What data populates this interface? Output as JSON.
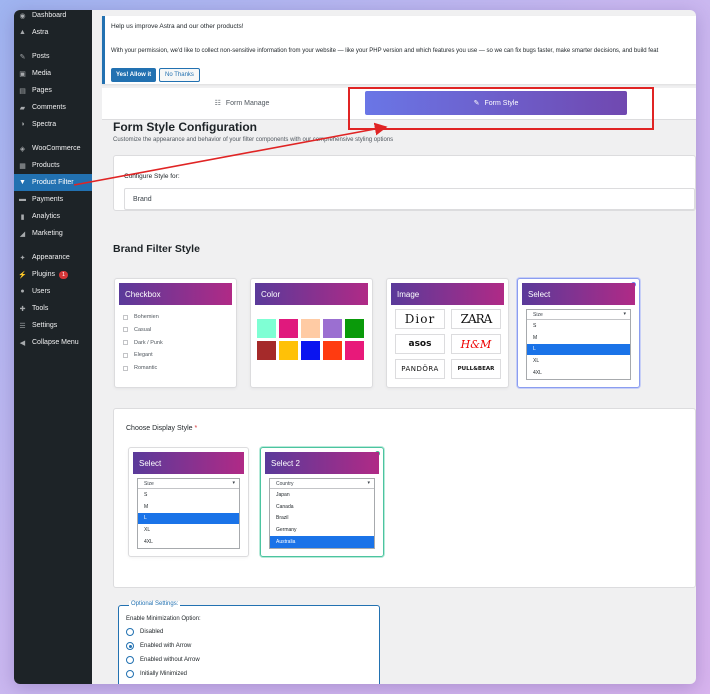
{
  "sidebar": {
    "items": [
      {
        "label": "Dashboard",
        "icon": "dashboard-icon",
        "glyph": "◉"
      },
      {
        "label": "Astra",
        "icon": "astra-icon",
        "glyph": "▲"
      },
      {
        "label": "Posts",
        "icon": "pin-icon",
        "glyph": "✎"
      },
      {
        "label": "Media",
        "icon": "media-icon",
        "glyph": "▣"
      },
      {
        "label": "Pages",
        "icon": "pages-icon",
        "glyph": "▤"
      },
      {
        "label": "Comments",
        "icon": "comments-icon",
        "glyph": "▰"
      },
      {
        "label": "Spectra",
        "icon": "spectra-icon",
        "glyph": "◑"
      },
      {
        "label": "WooCommerce",
        "icon": "woocommerce-icon",
        "glyph": "◈"
      },
      {
        "label": "Products",
        "icon": "products-icon",
        "glyph": "▦"
      },
      {
        "label": "Product Filter",
        "icon": "filter-icon",
        "glyph": "▼"
      },
      {
        "label": "Payments",
        "icon": "payments-icon",
        "glyph": "▬"
      },
      {
        "label": "Analytics",
        "icon": "analytics-icon",
        "glyph": "▮"
      },
      {
        "label": "Marketing",
        "icon": "marketing-icon",
        "glyph": "◢"
      },
      {
        "label": "Appearance",
        "icon": "appearance-icon",
        "glyph": "✦"
      },
      {
        "label": "Plugins",
        "icon": "plugins-icon",
        "glyph": "⚡",
        "badge": "1"
      },
      {
        "label": "Users",
        "icon": "users-icon",
        "glyph": "●"
      },
      {
        "label": "Tools",
        "icon": "tools-icon",
        "glyph": "✚"
      },
      {
        "label": "Settings",
        "icon": "settings-icon",
        "glyph": "☰"
      },
      {
        "label": "Collapse Menu",
        "icon": "collapse-icon",
        "glyph": "◀"
      }
    ]
  },
  "notice": {
    "title": "Help us improve Astra and our other products!",
    "body": "With your permission, we'd like to collect non-sensitive information from your website — like your PHP version and which features you use — so we can fix bugs faster, make smarter decisions, and build feat",
    "allow_label": "Yes! Allow it",
    "decline_label": "No Thanks"
  },
  "tabs": {
    "manage": {
      "label": "Form Manage",
      "glyph": "☷"
    },
    "style": {
      "label": "Form Style",
      "glyph": "✎"
    }
  },
  "page": {
    "title": "Form Style Configuration",
    "subtitle": "Customize the appearance and behavior of your filter components with our comprehensive styling options"
  },
  "configure": {
    "label": "Configure Style for:",
    "value": "Brand"
  },
  "brand_filter": {
    "title": "Brand Filter Style",
    "checkbox": {
      "title": "Checkbox",
      "items": [
        "Bohemien",
        "Casual",
        "Dark / Punk",
        "Elegant",
        "Romantic"
      ]
    },
    "color": {
      "title": "Color",
      "swatches": [
        "#7fffd4",
        "#e0197d",
        "#ffcba4",
        "#9b6fd1",
        "#0a9a0a",
        "#a52a2a",
        "#ffc107",
        "#0a14f0",
        "#ff3b10",
        "#e8197a"
      ]
    },
    "image": {
      "title": "Image",
      "logos": [
        "Dior",
        "ZARA",
        "asos",
        "H&M",
        "PANDÖRA",
        "PULL&BEAR"
      ]
    },
    "select": {
      "title": "Select",
      "placeholder": "Size",
      "options": [
        "S",
        "M",
        "L",
        "XL",
        "4XL"
      ],
      "highlighted": "L"
    }
  },
  "display_style": {
    "label": "Choose Display Style",
    "required": "*",
    "select": {
      "title": "Select",
      "placeholder": "Size",
      "options": [
        "S",
        "M",
        "L",
        "XL",
        "4XL"
      ],
      "highlighted": "L"
    },
    "select2": {
      "title": "Select 2",
      "placeholder": "Country",
      "options": [
        "Japan",
        "Canada",
        "Brazil",
        "Germany",
        "Australia"
      ],
      "highlighted": "Australia"
    }
  },
  "optional": {
    "legend": "Optional Settings:",
    "label": "Enable Minimization Option:",
    "options": [
      "Disabled",
      "Enabled with Arrow",
      "Enabled without Arrow",
      "Initially Minimized"
    ],
    "selected": "Enabled with Arrow"
  },
  "colors": {
    "accent": "#2271b1",
    "highlight_red": "#e02424",
    "header_gradient_start": "#5a3a9a",
    "header_gradient_end": "#b02a86"
  }
}
